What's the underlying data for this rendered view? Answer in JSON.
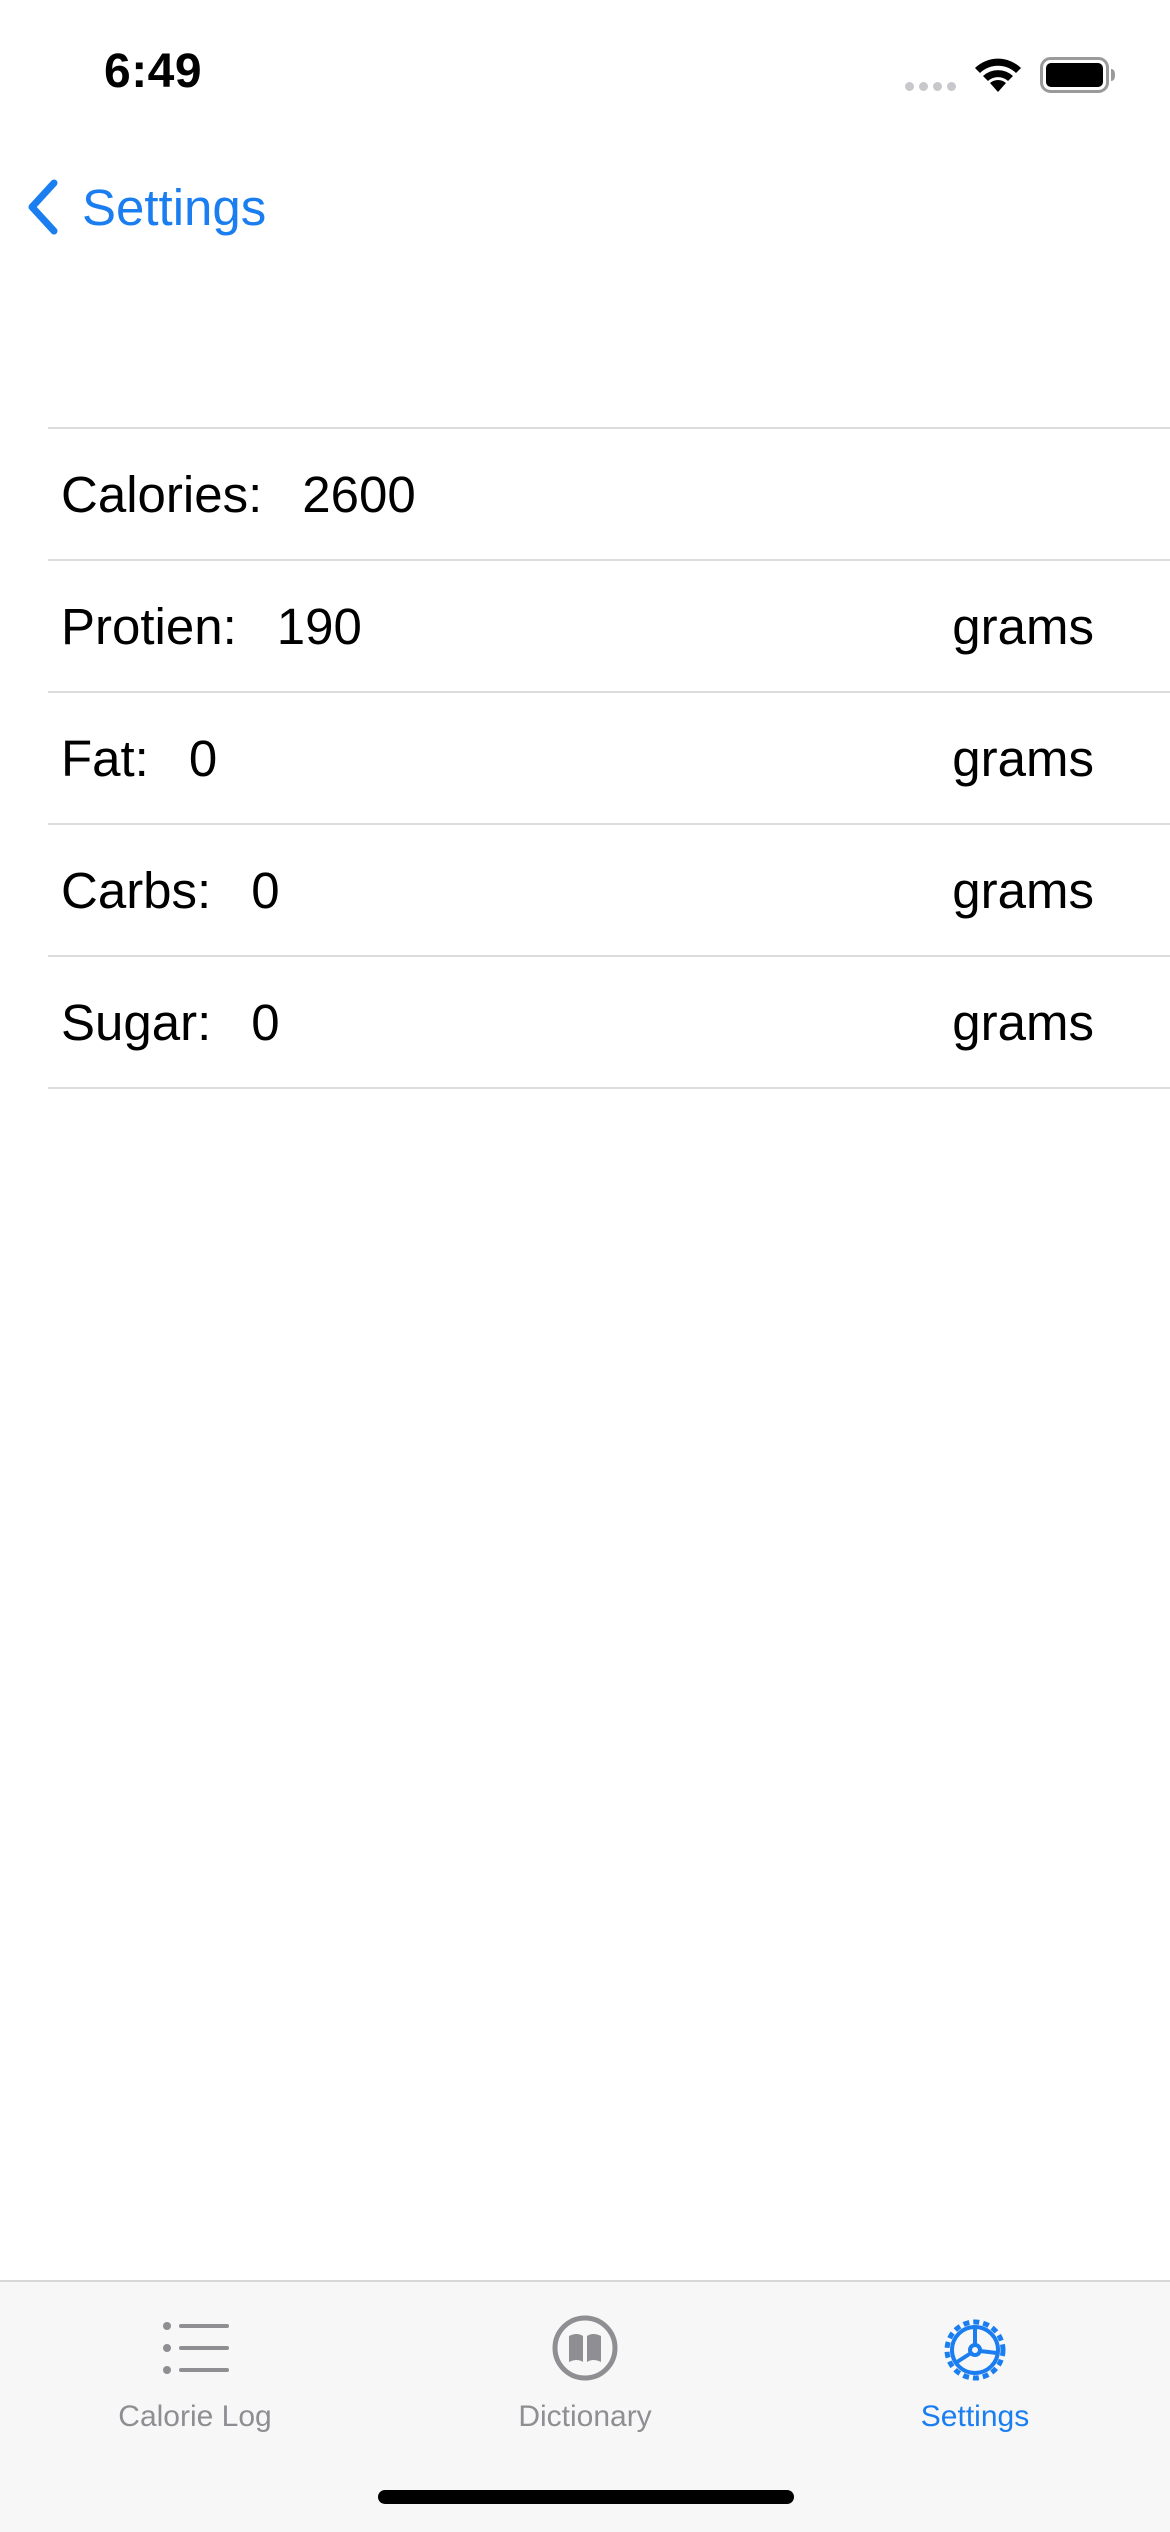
{
  "status_bar": {
    "time": "6:49",
    "icons": [
      "cellular-signal-icon",
      "wifi-icon",
      "battery-icon"
    ]
  },
  "nav": {
    "back_label": "Settings",
    "back_icon": "chevron-left-icon"
  },
  "nutrients": [
    {
      "label": "Calories:",
      "value": "2600",
      "unit": ""
    },
    {
      "label": "Protien:",
      "value": "190",
      "unit": "grams"
    },
    {
      "label": "Fat:",
      "value": "0",
      "unit": "grams"
    },
    {
      "label": "Carbs:",
      "value": "0",
      "unit": "grams"
    },
    {
      "label": "Sugar:",
      "value": "0",
      "unit": "grams"
    }
  ],
  "tab_bar": {
    "tabs": [
      {
        "label": "Calorie Log",
        "icon": "list-icon",
        "active": false
      },
      {
        "label": "Dictionary",
        "icon": "book-icon",
        "active": false
      },
      {
        "label": "Settings",
        "icon": "gear-icon",
        "active": true
      }
    ]
  },
  "colors": {
    "accent": "#1a7ef0",
    "inactive": "#8e8e93",
    "divider": "#dcdcdf",
    "tab_bar_bg": "#f7f7f7"
  }
}
